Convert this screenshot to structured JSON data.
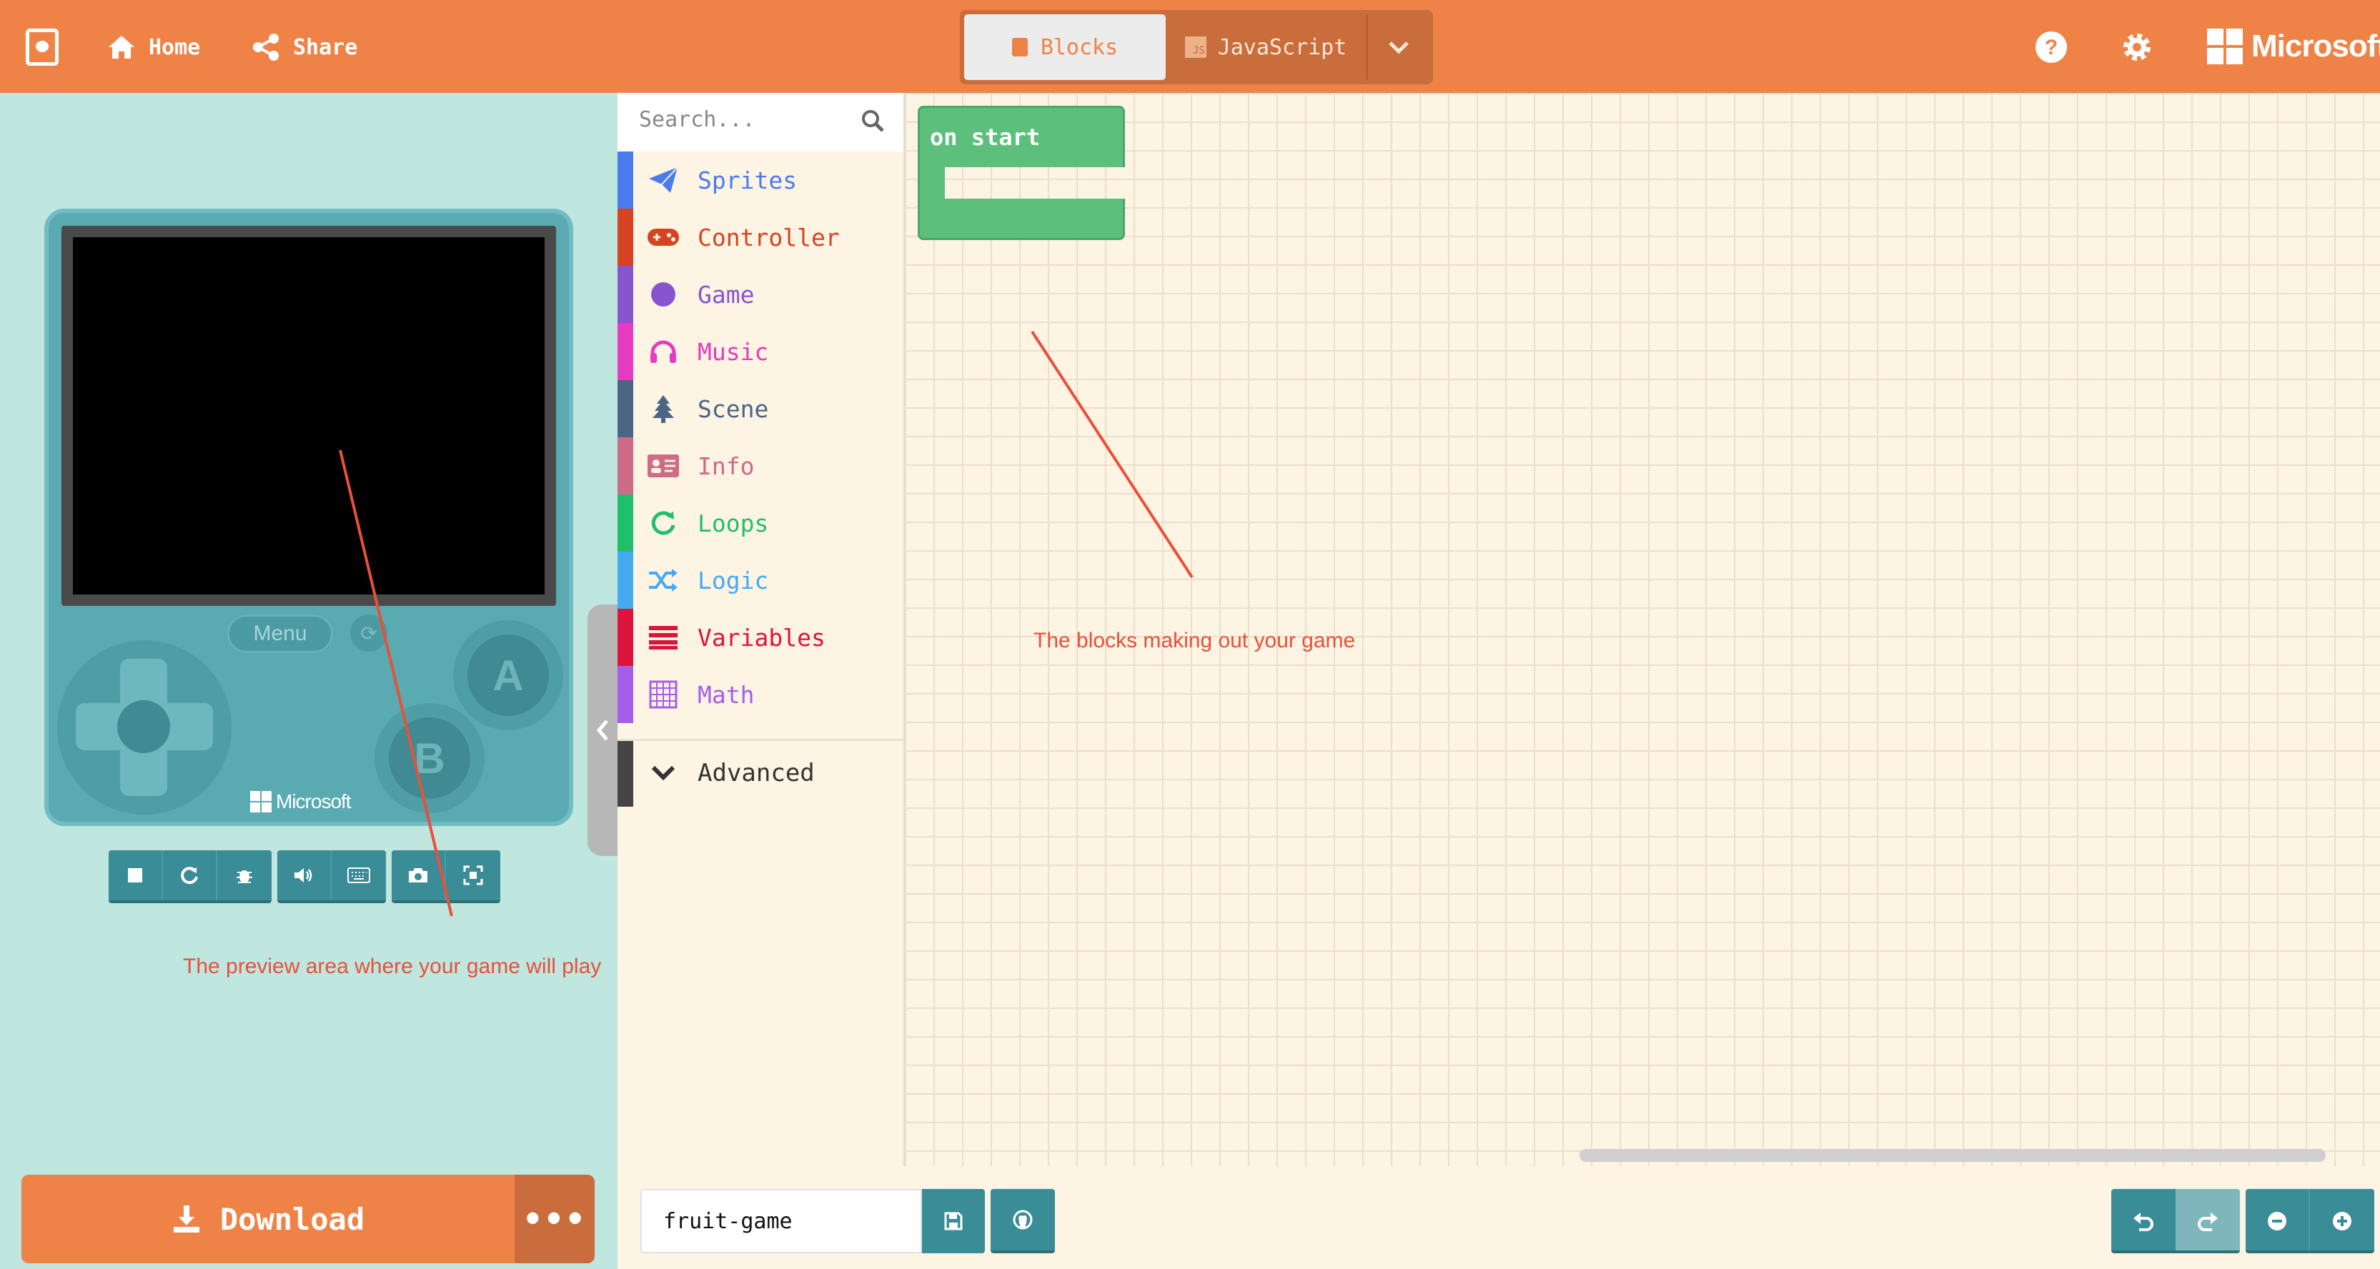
{
  "header": {
    "home_label": "Home",
    "share_label": "Share",
    "editor_tabs": [
      {
        "label": "Blocks",
        "active": true
      },
      {
        "label": "JavaScript",
        "active": false
      }
    ],
    "brand": "Microsoft"
  },
  "simulator": {
    "menu_label": "Menu",
    "button_a": "A",
    "button_b": "B",
    "device_brand": "Microsoft",
    "tools": [
      "stop-icon",
      "restart-icon",
      "debug-icon",
      "mute-icon",
      "keyboard-icon",
      "screenshot-icon",
      "fullscreen-icon"
    ]
  },
  "download": {
    "label": "Download",
    "more_label": "•••"
  },
  "toolbox": {
    "search_placeholder": "Search...",
    "categories": [
      {
        "label": "Sprites",
        "color": "#4b7bec",
        "icon": "paper-plane-icon"
      },
      {
        "label": "Controller",
        "color": "#d54322",
        "icon": "gamepad-icon"
      },
      {
        "label": "Game",
        "color": "#8854d0",
        "icon": "circle-icon"
      },
      {
        "label": "Music",
        "color": "#e63cc0",
        "icon": "headphones-icon"
      },
      {
        "label": "Scene",
        "color": "#4b6584",
        "icon": "tree-icon"
      },
      {
        "label": "Info",
        "color": "#cf6a87",
        "icon": "id-card-icon"
      },
      {
        "label": "Loops",
        "color": "#20bf6b",
        "icon": "refresh-icon"
      },
      {
        "label": "Logic",
        "color": "#45aaf2",
        "icon": "shuffle-icon"
      },
      {
        "label": "Variables",
        "color": "#dc143c",
        "icon": "list-icon"
      },
      {
        "label": "Math",
        "color": "#a55eea",
        "icon": "calculator-icon"
      }
    ],
    "advanced_label": "Advanced"
  },
  "workspace": {
    "block_label": "on start"
  },
  "project": {
    "name": "fruit-game"
  },
  "annotations": {
    "preview": "The preview area where your game will play",
    "blocks": "The blocks making out your game"
  },
  "colors": {
    "accent": "#ef8347",
    "teal": "#3a8c96",
    "sim_bg": "#bfe6df",
    "block_green": "#5cbf7b",
    "annotation": "#e8503a"
  }
}
